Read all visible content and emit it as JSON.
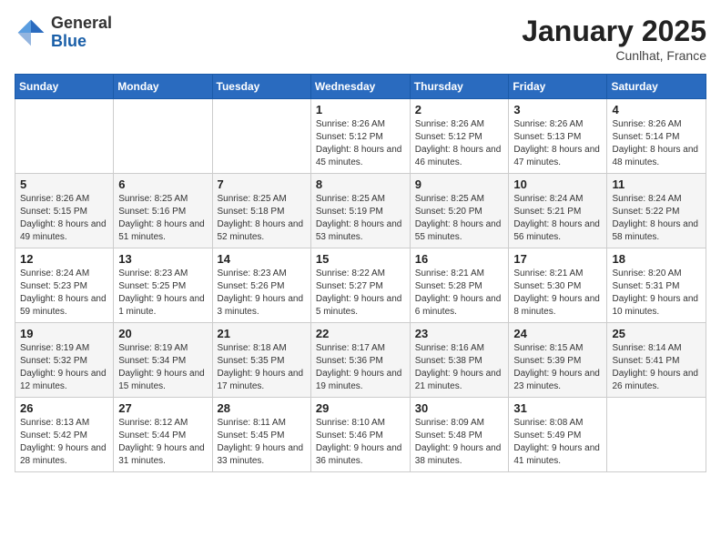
{
  "logo": {
    "line1": "General",
    "line2": "Blue"
  },
  "header": {
    "month": "January 2025",
    "location": "Cunlhat, France"
  },
  "weekdays": [
    "Sunday",
    "Monday",
    "Tuesday",
    "Wednesday",
    "Thursday",
    "Friday",
    "Saturday"
  ],
  "weeks": [
    [
      {
        "day": "",
        "sunrise": "",
        "sunset": "",
        "daylight": ""
      },
      {
        "day": "",
        "sunrise": "",
        "sunset": "",
        "daylight": ""
      },
      {
        "day": "",
        "sunrise": "",
        "sunset": "",
        "daylight": ""
      },
      {
        "day": "1",
        "sunrise": "Sunrise: 8:26 AM",
        "sunset": "Sunset: 5:12 PM",
        "daylight": "Daylight: 8 hours and 45 minutes."
      },
      {
        "day": "2",
        "sunrise": "Sunrise: 8:26 AM",
        "sunset": "Sunset: 5:12 PM",
        "daylight": "Daylight: 8 hours and 46 minutes."
      },
      {
        "day": "3",
        "sunrise": "Sunrise: 8:26 AM",
        "sunset": "Sunset: 5:13 PM",
        "daylight": "Daylight: 8 hours and 47 minutes."
      },
      {
        "day": "4",
        "sunrise": "Sunrise: 8:26 AM",
        "sunset": "Sunset: 5:14 PM",
        "daylight": "Daylight: 8 hours and 48 minutes."
      }
    ],
    [
      {
        "day": "5",
        "sunrise": "Sunrise: 8:26 AM",
        "sunset": "Sunset: 5:15 PM",
        "daylight": "Daylight: 8 hours and 49 minutes."
      },
      {
        "day": "6",
        "sunrise": "Sunrise: 8:25 AM",
        "sunset": "Sunset: 5:16 PM",
        "daylight": "Daylight: 8 hours and 51 minutes."
      },
      {
        "day": "7",
        "sunrise": "Sunrise: 8:25 AM",
        "sunset": "Sunset: 5:18 PM",
        "daylight": "Daylight: 8 hours and 52 minutes."
      },
      {
        "day": "8",
        "sunrise": "Sunrise: 8:25 AM",
        "sunset": "Sunset: 5:19 PM",
        "daylight": "Daylight: 8 hours and 53 minutes."
      },
      {
        "day": "9",
        "sunrise": "Sunrise: 8:25 AM",
        "sunset": "Sunset: 5:20 PM",
        "daylight": "Daylight: 8 hours and 55 minutes."
      },
      {
        "day": "10",
        "sunrise": "Sunrise: 8:24 AM",
        "sunset": "Sunset: 5:21 PM",
        "daylight": "Daylight: 8 hours and 56 minutes."
      },
      {
        "day": "11",
        "sunrise": "Sunrise: 8:24 AM",
        "sunset": "Sunset: 5:22 PM",
        "daylight": "Daylight: 8 hours and 58 minutes."
      }
    ],
    [
      {
        "day": "12",
        "sunrise": "Sunrise: 8:24 AM",
        "sunset": "Sunset: 5:23 PM",
        "daylight": "Daylight: 8 hours and 59 minutes."
      },
      {
        "day": "13",
        "sunrise": "Sunrise: 8:23 AM",
        "sunset": "Sunset: 5:25 PM",
        "daylight": "Daylight: 9 hours and 1 minute."
      },
      {
        "day": "14",
        "sunrise": "Sunrise: 8:23 AM",
        "sunset": "Sunset: 5:26 PM",
        "daylight": "Daylight: 9 hours and 3 minutes."
      },
      {
        "day": "15",
        "sunrise": "Sunrise: 8:22 AM",
        "sunset": "Sunset: 5:27 PM",
        "daylight": "Daylight: 9 hours and 5 minutes."
      },
      {
        "day": "16",
        "sunrise": "Sunrise: 8:21 AM",
        "sunset": "Sunset: 5:28 PM",
        "daylight": "Daylight: 9 hours and 6 minutes."
      },
      {
        "day": "17",
        "sunrise": "Sunrise: 8:21 AM",
        "sunset": "Sunset: 5:30 PM",
        "daylight": "Daylight: 9 hours and 8 minutes."
      },
      {
        "day": "18",
        "sunrise": "Sunrise: 8:20 AM",
        "sunset": "Sunset: 5:31 PM",
        "daylight": "Daylight: 9 hours and 10 minutes."
      }
    ],
    [
      {
        "day": "19",
        "sunrise": "Sunrise: 8:19 AM",
        "sunset": "Sunset: 5:32 PM",
        "daylight": "Daylight: 9 hours and 12 minutes."
      },
      {
        "day": "20",
        "sunrise": "Sunrise: 8:19 AM",
        "sunset": "Sunset: 5:34 PM",
        "daylight": "Daylight: 9 hours and 15 minutes."
      },
      {
        "day": "21",
        "sunrise": "Sunrise: 8:18 AM",
        "sunset": "Sunset: 5:35 PM",
        "daylight": "Daylight: 9 hours and 17 minutes."
      },
      {
        "day": "22",
        "sunrise": "Sunrise: 8:17 AM",
        "sunset": "Sunset: 5:36 PM",
        "daylight": "Daylight: 9 hours and 19 minutes."
      },
      {
        "day": "23",
        "sunrise": "Sunrise: 8:16 AM",
        "sunset": "Sunset: 5:38 PM",
        "daylight": "Daylight: 9 hours and 21 minutes."
      },
      {
        "day": "24",
        "sunrise": "Sunrise: 8:15 AM",
        "sunset": "Sunset: 5:39 PM",
        "daylight": "Daylight: 9 hours and 23 minutes."
      },
      {
        "day": "25",
        "sunrise": "Sunrise: 8:14 AM",
        "sunset": "Sunset: 5:41 PM",
        "daylight": "Daylight: 9 hours and 26 minutes."
      }
    ],
    [
      {
        "day": "26",
        "sunrise": "Sunrise: 8:13 AM",
        "sunset": "Sunset: 5:42 PM",
        "daylight": "Daylight: 9 hours and 28 minutes."
      },
      {
        "day": "27",
        "sunrise": "Sunrise: 8:12 AM",
        "sunset": "Sunset: 5:44 PM",
        "daylight": "Daylight: 9 hours and 31 minutes."
      },
      {
        "day": "28",
        "sunrise": "Sunrise: 8:11 AM",
        "sunset": "Sunset: 5:45 PM",
        "daylight": "Daylight: 9 hours and 33 minutes."
      },
      {
        "day": "29",
        "sunrise": "Sunrise: 8:10 AM",
        "sunset": "Sunset: 5:46 PM",
        "daylight": "Daylight: 9 hours and 36 minutes."
      },
      {
        "day": "30",
        "sunrise": "Sunrise: 8:09 AM",
        "sunset": "Sunset: 5:48 PM",
        "daylight": "Daylight: 9 hours and 38 minutes."
      },
      {
        "day": "31",
        "sunrise": "Sunrise: 8:08 AM",
        "sunset": "Sunset: 5:49 PM",
        "daylight": "Daylight: 9 hours and 41 minutes."
      },
      {
        "day": "",
        "sunrise": "",
        "sunset": "",
        "daylight": ""
      }
    ]
  ]
}
